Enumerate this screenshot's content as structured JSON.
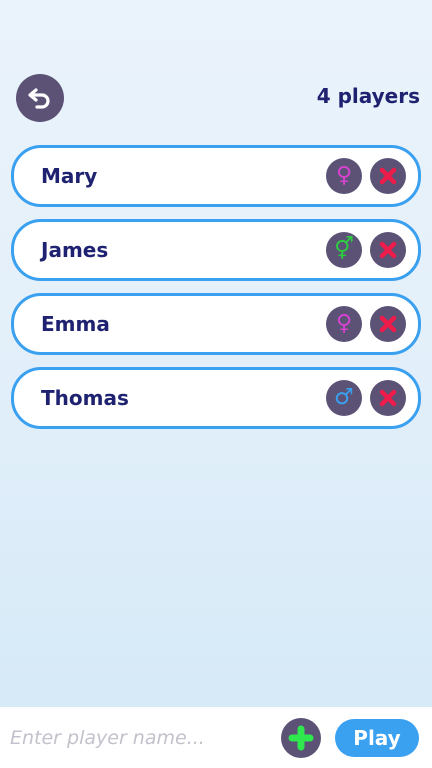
{
  "header": {
    "player_count_label": "4 players"
  },
  "players": [
    {
      "name": "Mary",
      "gender": "female",
      "gender_symbol": "♀",
      "gender_color": "#d742d0",
      "gender_icon": "female-icon"
    },
    {
      "name": "James",
      "gender": "neutral",
      "gender_symbol": "⚥",
      "gender_color": "#2ecc40",
      "gender_icon": "gender-neutral-icon"
    },
    {
      "name": "Emma",
      "gender": "female",
      "gender_symbol": "♀",
      "gender_color": "#d742d0",
      "gender_icon": "female-icon"
    },
    {
      "name": "Thomas",
      "gender": "male",
      "gender_symbol": "♂",
      "gender_color": "#3aa0f0",
      "gender_icon": "male-icon"
    }
  ],
  "icons": {
    "back": "back-arrow-icon",
    "remove": "close-icon",
    "add": "plus-icon"
  },
  "colors": {
    "accent_blue": "#3aa0f0",
    "button_purple": "#5b5276",
    "text_navy": "#1f2270",
    "remove_red": "#ee1c4b",
    "add_green": "#2ee84e"
  },
  "footer": {
    "input_placeholder": "Enter player name...",
    "input_value": "",
    "play_label": "Play"
  }
}
